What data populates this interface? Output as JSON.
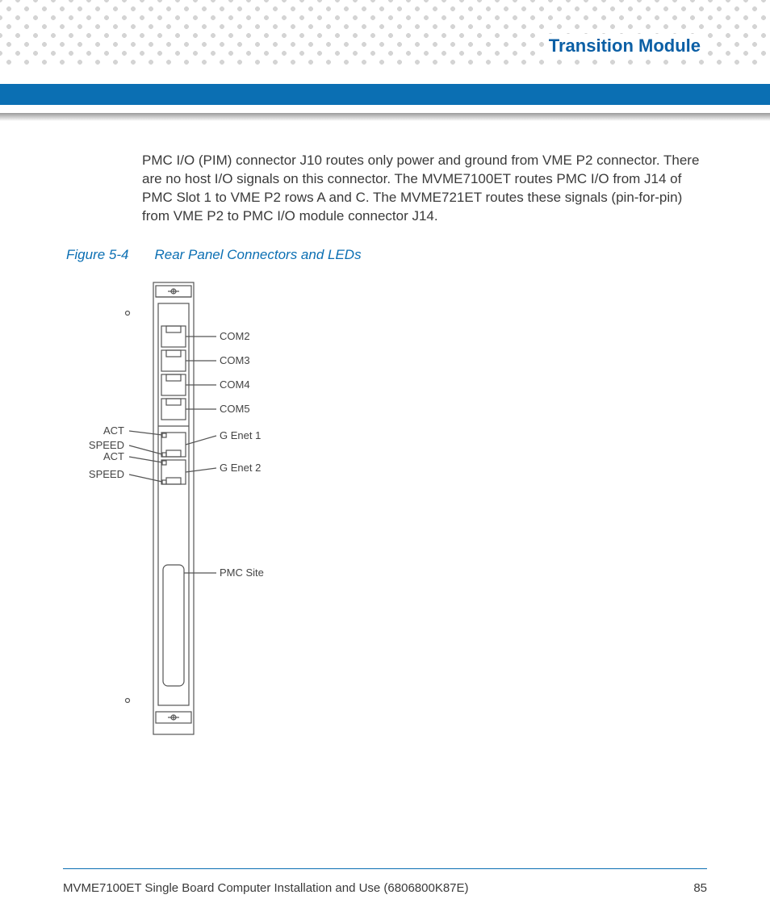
{
  "header": {
    "section_title": "Transition Module"
  },
  "body": {
    "paragraph": "PMC I/O (PIM) connector J10 routes only power and ground from VME P2 connector. There are no host I/O signals on this connector. The MVME7100ET routes PMC I/O from J14 of PMC Slot 1 to VME P2 rows A and C. The MVME721ET routes these signals (pin-for-pin) from VME P2 to PMC I/O module connector J14."
  },
  "figure": {
    "number": "Figure 5-4",
    "title": "Rear Panel Connectors and LEDs",
    "labels": {
      "com2": "COM2",
      "com3": "COM3",
      "com4": "COM4",
      "com5": "COM5",
      "enet1": "G Enet 1",
      "enet2": "G Enet 2",
      "act1": "ACT",
      "speed1": "SPEED",
      "act2": "ACT",
      "speed2": "SPEED",
      "pmc": "PMC Site"
    }
  },
  "footer": {
    "doc_title": "MVME7100ET Single Board Computer Installation and Use (6806800K87E)",
    "page_number": "85"
  }
}
